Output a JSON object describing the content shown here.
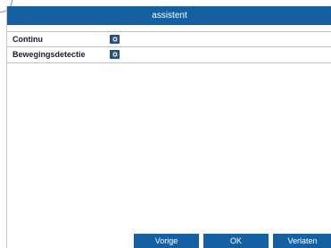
{
  "dialog": {
    "title": "assistent"
  },
  "schedule_rows": [
    {
      "label": "Continu",
      "settings_icon": "gear-icon"
    },
    {
      "label": "Bewegingsdetectie",
      "settings_icon": "gear-icon"
    }
  ],
  "buttons": {
    "previous": "Vorige",
    "ok": "OK",
    "exit": "Verlaten"
  },
  "colors": {
    "accent": "#1460a3",
    "icon_button": "#1f4f7f",
    "label_text": "#1a1a2e"
  }
}
